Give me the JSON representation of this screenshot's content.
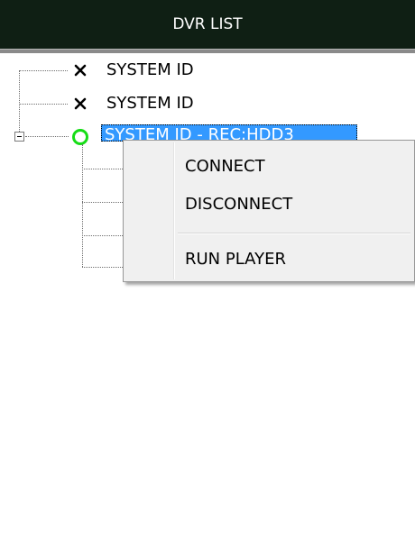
{
  "panel": {
    "title": "DVR LIST"
  },
  "tree": {
    "items": [
      {
        "label": "SYSTEM ID",
        "status_icon": "x-icon"
      },
      {
        "label": "SYSTEM ID",
        "status_icon": "x-icon"
      },
      {
        "label": "SYSTEM ID - REC:HDD3",
        "status_icon": "connected-circle-icon",
        "selected": true,
        "expanded": true
      }
    ]
  },
  "context_menu": {
    "items": [
      {
        "label": "CONNECT"
      },
      {
        "label": "DISCONNECT"
      },
      {
        "label": "RUN PLAYER"
      }
    ]
  },
  "colors": {
    "header_bg": "#0f1f14",
    "selection": "#3399ff",
    "connected": "#16dd16"
  }
}
